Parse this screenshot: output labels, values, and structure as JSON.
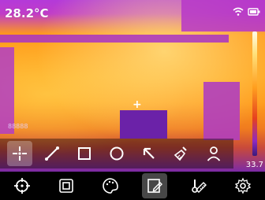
{
  "status_bar": {
    "temperature": "28.2°C",
    "wifi_icon": "wifi-icon",
    "battery_icon": "battery-icon"
  },
  "thermal_view": {
    "crosshair": "+",
    "small_label": "88888",
    "scale_min": "33.7"
  },
  "measure_toolbar": {
    "items": [
      {
        "icon": "center-point-icon",
        "active": true
      },
      {
        "icon": "line-icon",
        "active": false
      },
      {
        "icon": "rectangle-icon",
        "active": false
      },
      {
        "icon": "circle-icon",
        "active": false
      },
      {
        "icon": "arrow-up-left-icon",
        "active": false
      },
      {
        "icon": "broom-icon",
        "active": false
      },
      {
        "icon": "person-icon",
        "active": false
      }
    ]
  },
  "bottom_toolbar": {
    "items": [
      {
        "icon": "target-icon",
        "active": false
      },
      {
        "icon": "layers-icon",
        "active": false
      },
      {
        "icon": "palette-icon",
        "active": false
      },
      {
        "icon": "edit-frame-icon",
        "active": true
      },
      {
        "icon": "thermometer-ruler-icon",
        "active": false
      },
      {
        "icon": "settings-icon",
        "active": false
      }
    ]
  },
  "colors": {
    "accent": "#ffffff"
  }
}
